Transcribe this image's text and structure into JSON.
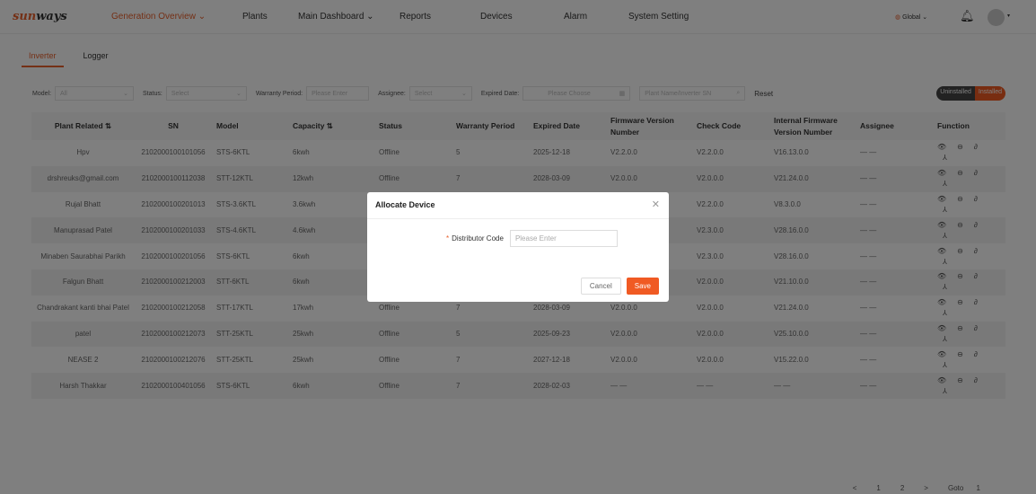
{
  "brand": {
    "logo": "sunways"
  },
  "nav": [
    {
      "label": "Generation Overview ⌄",
      "active": true
    },
    {
      "label": "Plants"
    },
    {
      "label": "Main Dashboard ⌄"
    },
    {
      "label": "Reports"
    },
    {
      "label": "Devices"
    },
    {
      "label": "Alarm"
    },
    {
      "label": "System Setting"
    }
  ],
  "header": {
    "region": "Global ⌄"
  },
  "tabs": [
    {
      "label": "Inverter",
      "active": true
    },
    {
      "label": "Logger"
    }
  ],
  "filters": {
    "model_label": "Model:",
    "model_value": "All",
    "status_label": "Status:",
    "status_placeholder": "Select",
    "warranty_label": "Warranty Period:",
    "warranty_placeholder": "Please Enter",
    "assignee_label": "Assignee:",
    "assignee_placeholder": "Select",
    "expired_label": "Expired Date:",
    "expired_placeholder": "Please Choose",
    "search_placeholder": "Plant Name/Inverter SN",
    "reset": "Reset",
    "uninstalled": "Uninstalled",
    "installed": "Installed"
  },
  "colors": {
    "accent": "#f05a23",
    "toggle_dark": "#444444"
  },
  "table": {
    "headers": [
      "Plant Related ⇅",
      "SN",
      "Model",
      "Capacity ⇅",
      "Status",
      "Warranty Period",
      "Expired Date",
      "Firmware Version Number",
      "Check Code",
      "Internal Firmware Version Number",
      "Assignee",
      "Function"
    ],
    "rows": [
      [
        "Hpv",
        "2102000100101056",
        "STS-6KTL",
        "6kwh",
        "Offline",
        "5",
        "2025-12-18",
        "V2.2.0.0",
        "V2.2.0.0",
        "V16.13.0.0",
        "— —"
      ],
      [
        "drshreuks@gmail.com",
        "2102000100112038",
        "STT-12KTL",
        "12kwh",
        "Offline",
        "7",
        "2028-03-09",
        "V2.0.0.0",
        "V2.0.0.0",
        "V21.24.0.0",
        "— —"
      ],
      [
        "Rujal Bhatt",
        "2102000100201013",
        "STS-3.6KTL",
        "3.6kwh",
        "",
        "",
        "",
        "",
        "V2.2.0.0",
        "V8.3.0.0",
        "— —"
      ],
      [
        "Manuprasad Patel",
        "2102000100201033",
        "STS-4.6KTL",
        "4.6kwh",
        "",
        "",
        "",
        "",
        "V2.3.0.0",
        "V28.16.0.0",
        "— —"
      ],
      [
        "Minaben Saurabhai Parikh",
        "2102000100201056",
        "STS-6KTL",
        "6kwh",
        "",
        "",
        "",
        "",
        "V2.3.0.0",
        "V28.16.0.0",
        "— —"
      ],
      [
        "Falgun Bhatt",
        "2102000100212003",
        "STT-6KTL",
        "6kwh",
        "",
        "",
        "",
        "",
        "V2.0.0.0",
        "V21.10.0.0",
        "— —"
      ],
      [
        "Chandrakant kanti bhai Patel",
        "2102000100212058",
        "STT-17KTL",
        "17kwh",
        "Offline",
        "7",
        "2028-03-09",
        "V2.0.0.0",
        "V2.0.0.0",
        "V21.24.0.0",
        "— —"
      ],
      [
        "patel",
        "2102000100212073",
        "STT-25KTL",
        "25kwh",
        "Offline",
        "5",
        "2025-09-23",
        "V2.0.0.0",
        "V2.0.0.0",
        "V25.10.0.0",
        "— —"
      ],
      [
        "NEASE 2",
        "2102000100212076",
        "STT-25KTL",
        "25kwh",
        "Offline",
        "7",
        "2027-12-18",
        "V2.0.0.0",
        "V2.0.0.0",
        "V15.22.0.0",
        "— —"
      ],
      [
        "Harsh Thakkar",
        "2102000100401056",
        "STS-6KTL",
        "6kwh",
        "Offline",
        "7",
        "2028-02-03",
        "— —",
        "— —",
        "— —",
        "— —"
      ]
    ]
  },
  "pagination": {
    "prev": "<",
    "pages": [
      "1",
      "2"
    ],
    "next": ">",
    "goto_label": "Goto",
    "goto_value": "1"
  },
  "modal": {
    "title": "Allocate Device",
    "close": "✕",
    "field_label": "Distributor Code",
    "required_mark": "*",
    "placeholder": "Please Enter",
    "cancel": "Cancel",
    "save": "Save"
  }
}
